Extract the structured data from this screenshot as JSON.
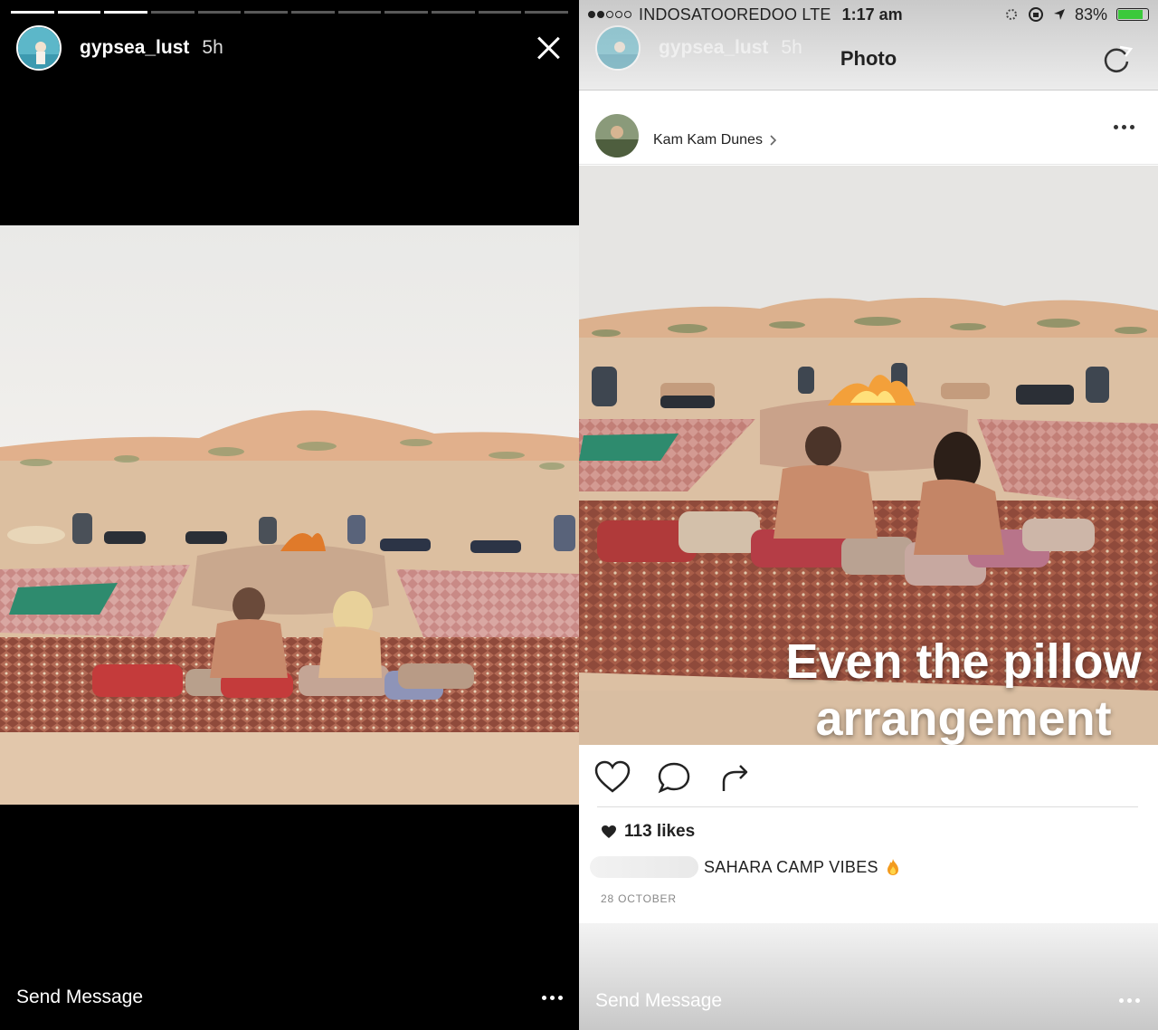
{
  "story": {
    "username": "gypsea_lust",
    "time": "5h",
    "send_message": "Send Message"
  },
  "status_bar": {
    "carrier": "INDOSATOOREDOO  LTE",
    "time": "1:17 am",
    "battery": "83%",
    "battery_level": 0.83
  },
  "post_view": {
    "title": "Photo",
    "location": "Kam Kam Dunes",
    "overlay_line1": "Even the pillow",
    "overlay_line2": "arrangement",
    "likes": "113 likes",
    "caption": "SAHARA CAMP VIBES",
    "date": "28 OCTOBER",
    "send_message": "Send Message"
  },
  "colors": {
    "battery_green": "#3bc93b",
    "sand": "#dcbfa0",
    "rug_red": "#9e4a3e"
  },
  "icons": [
    "close-icon",
    "more-icon",
    "refresh-icon",
    "heart-icon",
    "comment-icon",
    "share-icon",
    "chevron-right-icon",
    "fire-emoji-icon"
  ]
}
